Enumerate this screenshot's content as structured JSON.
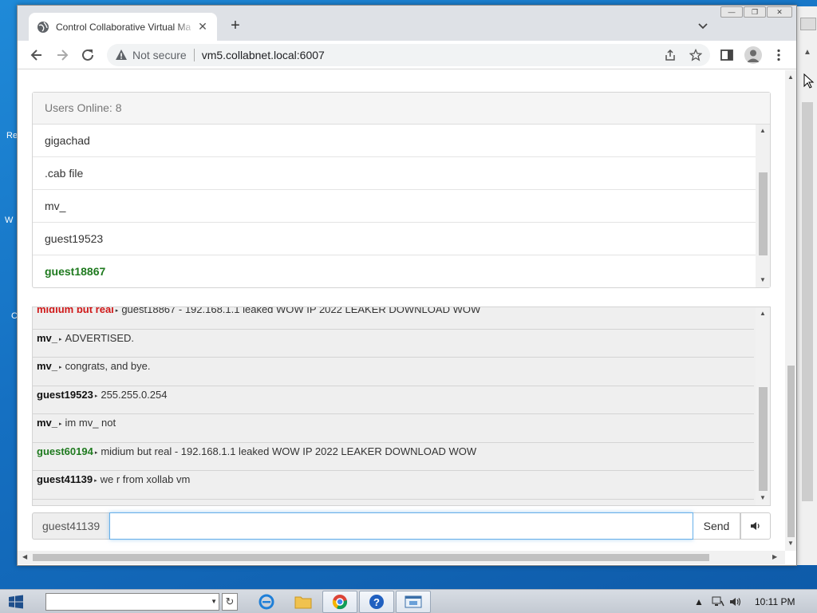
{
  "desktop": {
    "fragments": [
      "Re",
      "W",
      "C"
    ]
  },
  "browser": {
    "tab": {
      "title": "Control Collaborative Virtual Ma"
    },
    "window_controls": [
      "minimize",
      "restore",
      "close"
    ],
    "address": {
      "security_label": "Not secure",
      "url": "vm5.collabnet.local:6007"
    }
  },
  "users": {
    "header": "Users Online: 8",
    "items": [
      {
        "name": "gigachad",
        "is_self": false
      },
      {
        "name": ".cab file",
        "is_self": false
      },
      {
        "name": "mv_",
        "is_self": false
      },
      {
        "name": "guest19523",
        "is_self": false
      },
      {
        "name": "guest18867",
        "is_self": true
      }
    ]
  },
  "chat": {
    "messages": [
      {
        "user": "midium but real",
        "color": "#d01919",
        "text": "guest18867 - 192.168.1.1 leaked WOW IP 2022 LEAKER DOWNLOAD WOW"
      },
      {
        "user": "mv_",
        "color": "#111111",
        "text": "ADVERTISED."
      },
      {
        "user": "mv_",
        "color": "#111111",
        "text": "congrats, and bye."
      },
      {
        "user": "guest19523",
        "color": "#111111",
        "text": "255.255.0.254"
      },
      {
        "user": "mv_",
        "color": "#111111",
        "text": "im mv_ not"
      },
      {
        "user": "guest60194",
        "color": "#1f7a1f",
        "text": "midium but real - 192.168.1.1 leaked WOW IP 2022 LEAKER DOWNLOAD WOW"
      },
      {
        "user": "guest41139",
        "color": "#111111",
        "text": "we r from xollab vm"
      }
    ]
  },
  "composer": {
    "username": "guest41139",
    "input_value": "",
    "send_label": "Send"
  },
  "taskbar": {
    "combo_value": "",
    "clock": "10:11 PM"
  },
  "colors": {
    "self_user": "#1f7a1f",
    "accent_focus": "#66afe9"
  }
}
